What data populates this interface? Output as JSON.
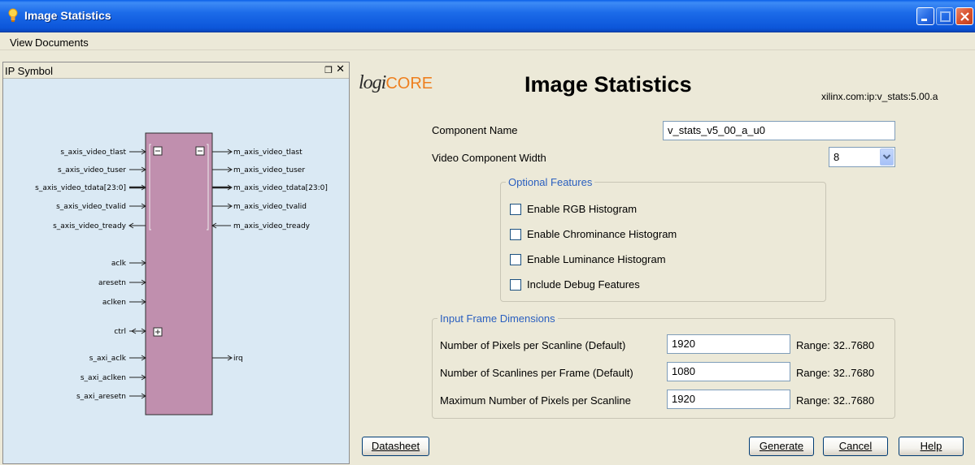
{
  "window": {
    "title": "Image Statistics"
  },
  "menu": {
    "view": "View",
    "documents": "Documents"
  },
  "ip_panel": {
    "title": "IP Symbol",
    "float_icon": "float-icon",
    "close_icon": "close-icon",
    "left_ports": [
      "s_axis_video_tlast",
      "s_axis_video_tuser",
      "s_axis_video_tdata[23:0]",
      "s_axis_video_tvalid",
      "s_axis_video_tready",
      "aclk",
      "aresetn",
      "aclken",
      "ctrl",
      "s_axi_aclk",
      "s_axi_aclken",
      "s_axi_aresetn"
    ],
    "right_ports": [
      "m_axis_video_tlast",
      "m_axis_video_tuser",
      "m_axis_video_tdata[23:0]",
      "m_axis_video_tvalid",
      "m_axis_video_tready",
      "irq"
    ],
    "block_color": "#c08fae"
  },
  "header": {
    "logo_logi": "logi",
    "logo_core": "CORE",
    "title": "Image Statistics",
    "vlnv": "xilinx.com:ip:v_stats:5.00.a"
  },
  "component_name": {
    "label": "Component Name",
    "value": "v_stats_v5_00_a_u0"
  },
  "video_width": {
    "label": "Video Component Width",
    "value": "8"
  },
  "optional_features": {
    "legend": "Optional Features",
    "items": [
      {
        "label": "Enable RGB Histogram",
        "checked": false
      },
      {
        "label": "Enable Chrominance Histogram",
        "checked": false
      },
      {
        "label": "Enable Luminance Histogram",
        "checked": false
      },
      {
        "label": "Include Debug Features",
        "checked": false
      }
    ]
  },
  "frame_dimensions": {
    "legend": "Input Frame Dimensions",
    "rows": [
      {
        "label": "Number of Pixels per Scanline (Default)",
        "value": "1920",
        "range": "Range: 32..7680"
      },
      {
        "label": "Number of Scanlines per Frame (Default)",
        "value": "1080",
        "range": "Range: 32..7680"
      },
      {
        "label": "Maximum Number of Pixels per Scanline",
        "value": "1920",
        "range": "Range: 32..7680"
      }
    ]
  },
  "buttons": {
    "datasheet": "Datasheet",
    "generate": "Generate",
    "cancel": "Cancel",
    "help": "Help"
  },
  "colors": {
    "legend": "#2a5fbf",
    "titlebar": "#0c56da",
    "panel_bg": "#dae9f4"
  }
}
